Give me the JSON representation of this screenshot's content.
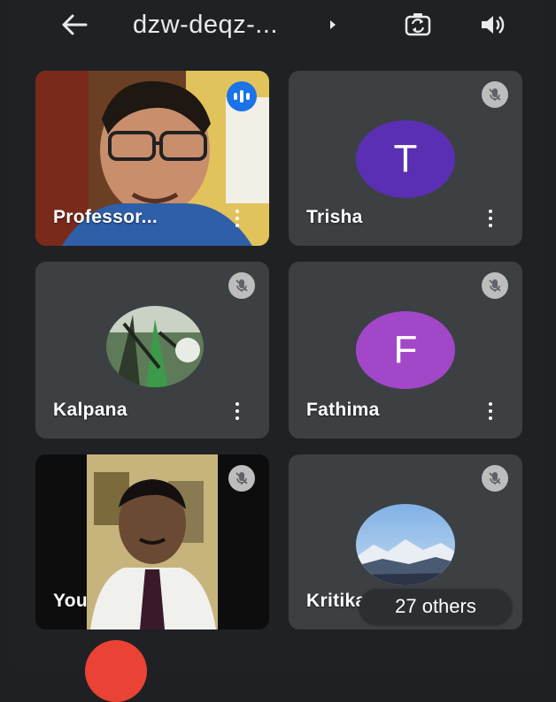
{
  "header": {
    "meeting_code": "dzw-deqz-...",
    "back_icon": "arrow-left-icon",
    "switch_camera_icon": "switch-camera-icon",
    "speaker_icon": "speaker-icon"
  },
  "participants": [
    {
      "name": "Professor...",
      "type": "video",
      "speaking": true
    },
    {
      "name": "Trisha",
      "type": "letter",
      "letter": "T",
      "avatar_color": "#5b2fb3",
      "muted": true
    },
    {
      "name": "Kalpana",
      "type": "photo",
      "muted": true
    },
    {
      "name": "Fathima",
      "type": "letter",
      "letter": "F",
      "avatar_color": "#a347c9",
      "muted": true
    },
    {
      "name": "You",
      "type": "video",
      "muted": true
    },
    {
      "name": "Kritika",
      "type": "photo",
      "muted": true
    }
  ],
  "others": {
    "label": "27 others"
  },
  "colors": {
    "background": "#202124",
    "tile": "#3c4043",
    "speaking": "#1a73e8",
    "end_call": "#ea4335"
  }
}
